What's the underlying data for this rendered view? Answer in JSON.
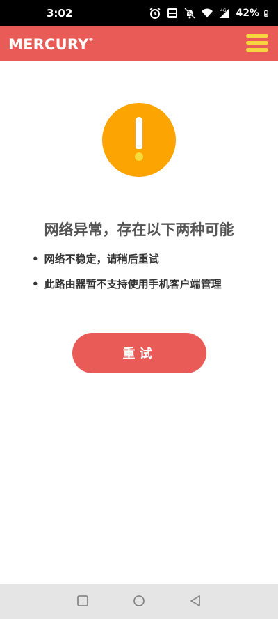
{
  "status_bar": {
    "time": "3:02",
    "battery_percent": "42%",
    "icons": [
      "alarm-icon",
      "volte-icon",
      "mute-icon",
      "wifi-icon",
      "signal-4g-icon",
      "battery-icon"
    ]
  },
  "header": {
    "brand": "MERCURY",
    "brand_mark": "®",
    "menu_icon": "hamburger-menu-icon",
    "background_color": "#e85b57",
    "menu_color": "#f7d540"
  },
  "error": {
    "icon": "warning-icon",
    "icon_color": "#fba402",
    "title": "网络异常，存在以下两种可能",
    "reasons": [
      "网络不稳定，请稍后重试",
      "此路由器暂不支持使用手机客户端管理"
    ]
  },
  "retry_button": {
    "label": "重试",
    "color": "#e85b57"
  },
  "nav_bar": {
    "icons": [
      "recent-apps-icon",
      "home-icon",
      "back-icon"
    ]
  }
}
